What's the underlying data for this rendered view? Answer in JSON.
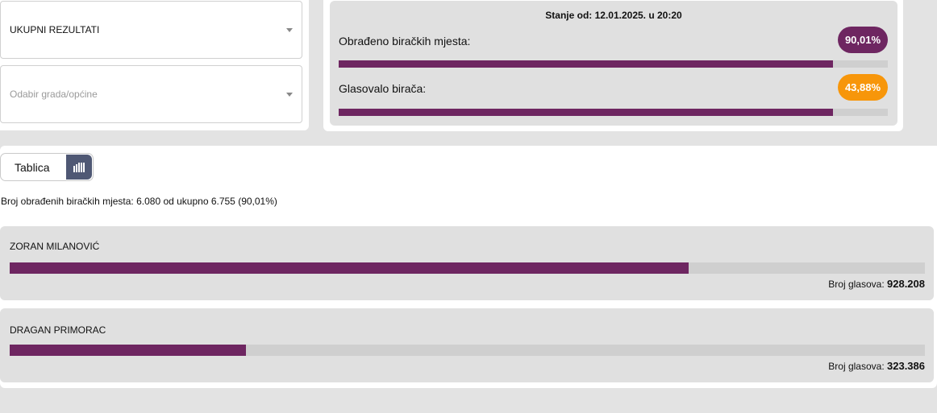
{
  "filters": {
    "results_select": {
      "value": "UKUPNI REZULTATI"
    },
    "city_select": {
      "placeholder": "Odabir grada/općine"
    }
  },
  "status": {
    "date_text": "Stanje od: 12.01.2025. u 20:20",
    "processed": {
      "label": "Obrađeno biračkih mjesta:",
      "value_text": "90,01%",
      "fraction": 0.9001,
      "color": "#6e2661"
    },
    "turnout": {
      "label": "Glasovalo birača:",
      "value_text": "43,88%",
      "fraction": 0.4388,
      "color": "#f7960a"
    }
  },
  "view_toggle": {
    "table_label": "Tablica",
    "chart_icon": "bar-chart-icon"
  },
  "summary_text": "Broj obrađenih biračkih mjesta: 6.080 od ukupno 6.755 (90,01%)",
  "candidates": [
    {
      "name": "ZORAN MILANOVIĆ",
      "votes_label": "Broj glasova:",
      "votes": "928.208",
      "fraction": 0.7416
    },
    {
      "name": "DRAGAN PRIMORAC",
      "votes_label": "Broj glasova:",
      "votes": "323.386",
      "fraction": 0.2584
    }
  ],
  "colors": {
    "accent": "#6e2661",
    "turnout_accent": "#f7960a",
    "toggle_active": "#4f5874"
  }
}
